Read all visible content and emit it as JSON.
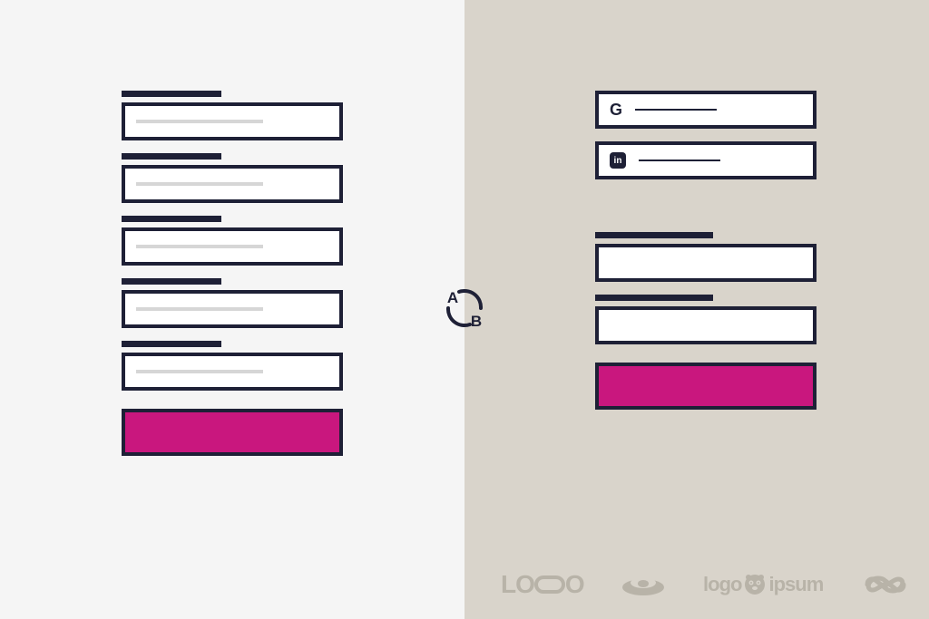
{
  "diagram": {
    "type": "ab-test-comparison",
    "variant_a": {
      "fields": [
        {
          "label_present": true,
          "placeholder_present": true
        },
        {
          "label_present": true,
          "placeholder_present": true
        },
        {
          "label_present": true,
          "placeholder_present": true
        },
        {
          "label_present": true,
          "placeholder_present": true
        },
        {
          "label_present": true,
          "placeholder_present": true
        }
      ],
      "cta_color": "#c9177e"
    },
    "variant_b": {
      "social_buttons": [
        {
          "icon": "G",
          "provider": "google"
        },
        {
          "icon": "in",
          "provider": "linkedin"
        }
      ],
      "fields": [
        {
          "label_present": true,
          "placeholder_present": false
        },
        {
          "label_present": true,
          "placeholder_present": false
        }
      ],
      "cta_color": "#c9177e"
    },
    "badge": {
      "a": "A",
      "b": "B"
    }
  },
  "footer_logos": [
    {
      "name": "logo",
      "text": "LO",
      "suffix": "O"
    },
    {
      "name": "logo-bear"
    },
    {
      "name": "logo-ipsum",
      "text_left": "logo",
      "text_right": "ipsum"
    },
    {
      "name": "logo-infinity"
    }
  ],
  "colors": {
    "dark": "#1e2036",
    "accent": "#c9177e",
    "bg_left": "#f5f5f5",
    "bg_right": "#d9d4cb",
    "muted": "#b8b3a8"
  }
}
